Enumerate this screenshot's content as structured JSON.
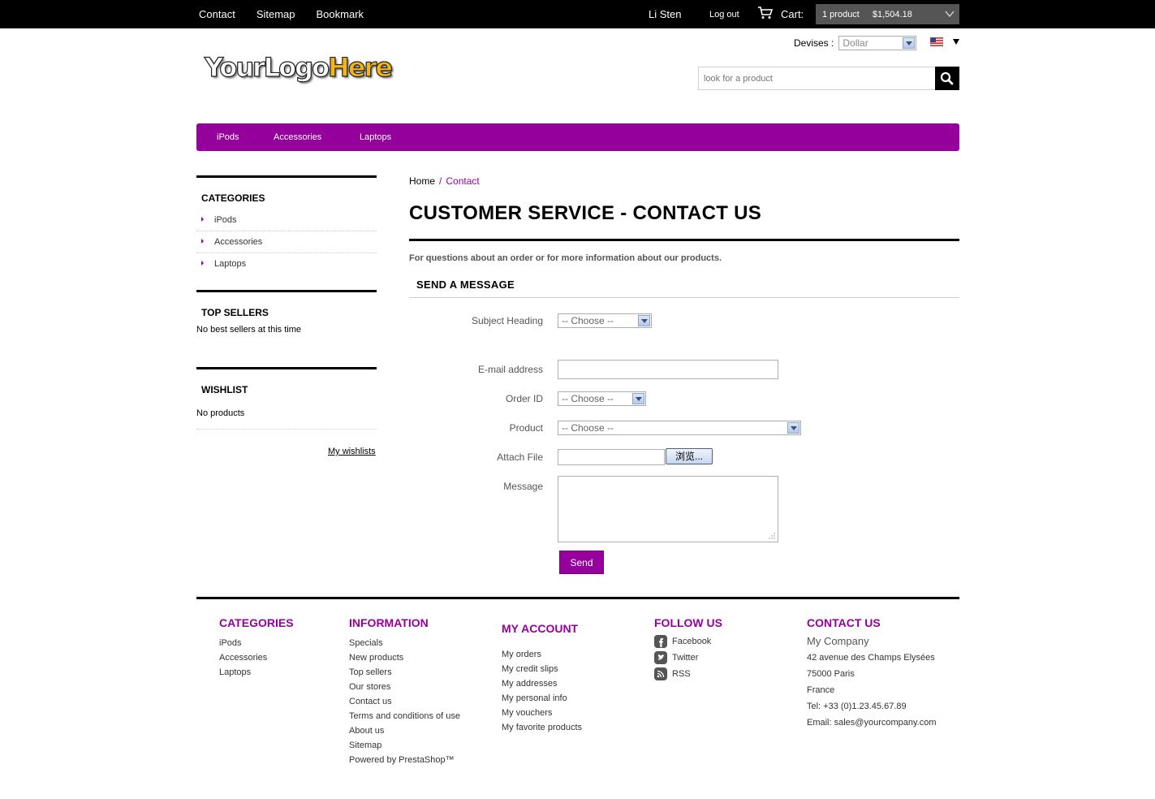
{
  "topbar": {
    "links": [
      "Contact",
      "Sitemap",
      "Bookmark"
    ],
    "user": "Li Sten",
    "logout": "Log out",
    "cart_label": "Cart:",
    "cart_qty": "1  product",
    "cart_total": "$1,504.18"
  },
  "header": {
    "currency_label": "Devises :",
    "currency_value": "Dollar",
    "logo_part1": "YourLogo",
    "logo_part2": "Here",
    "search_placeholder": "look for a product"
  },
  "menu": [
    "iPods",
    "Accessories",
    "Laptops"
  ],
  "sidebar": {
    "categories_title": "CATEGORIES",
    "categories": [
      "iPods",
      "Accessories",
      "Laptops"
    ],
    "top_sellers_title": "TOP SELLERS",
    "top_sellers_empty": "No best sellers at this time",
    "wishlist_title": "WISHLIST",
    "wishlist_empty": "No products",
    "my_wishlists": "My wishlists"
  },
  "breadcrumb": {
    "home": "Home",
    "sep": "/",
    "current": "Contact"
  },
  "page_title": "CUSTOMER SERVICE - CONTACT US",
  "intro": "For questions about an order or for more information about our products.",
  "form": {
    "title": "SEND A MESSAGE",
    "subject_label": "Subject Heading",
    "subject_value": "-- Choose --",
    "email_label": "E-mail address",
    "email_value": "",
    "order_label": "Order ID",
    "order_value": "-- Choose --",
    "product_label": "Product",
    "product_value": "-- Choose --",
    "attach_label": "Attach File",
    "browse_label": "浏览...",
    "message_label": "Message",
    "send_label": "Send"
  },
  "footer": {
    "categories": {
      "title": "CATEGORIES",
      "items": [
        "iPods",
        "Accessories",
        "Laptops"
      ]
    },
    "information": {
      "title": "INFORMATION",
      "items": [
        "Specials",
        "New products",
        "Top sellers",
        "Our stores",
        "Contact us",
        "Terms and conditions of use",
        "About us",
        "Sitemap",
        "Powered by PrestaShop™"
      ]
    },
    "account": {
      "title": "MY ACCOUNT",
      "items": [
        "My orders",
        "My credit slips",
        "My addresses",
        "My personal info",
        "My vouchers",
        "My favorite products"
      ]
    },
    "follow": {
      "title": "FOLLOW US",
      "items": [
        "Facebook",
        "Twitter",
        "RSS"
      ]
    },
    "contact": {
      "title": "CONTACT US",
      "company": "My Company",
      "lines": [
        "42 avenue des Champs Elysées",
        "75000 Paris",
        "France",
        "Tel: +33 (0)1.23.45.67.89",
        "Email: sales@yourcompany.com"
      ]
    }
  },
  "colors": {
    "accent": "#95009c",
    "topbar": "#000000"
  }
}
